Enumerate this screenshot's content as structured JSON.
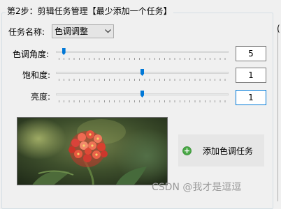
{
  "group": {
    "title": "第2步：剪辑任务管理【最少添加一个任务】"
  },
  "right_frame": {
    "glyph": "("
  },
  "task": {
    "label": "任务名称:",
    "selected": "色调调整"
  },
  "adjustments": {
    "hue": {
      "label": "色调角度:",
      "value": "5",
      "slider_fraction": 0.02
    },
    "saturation": {
      "label": "饱和度:",
      "value": "1",
      "slider_fraction": 0.5
    },
    "brightness": {
      "label": "亮度:",
      "value": "1",
      "slider_fraction": 0.5
    }
  },
  "preview": {
    "icon": "flower-photo"
  },
  "add_button": {
    "label": "添加色调任务",
    "icon": "plus-circle-icon"
  },
  "watermark": {
    "text": "CSDN @我才是逗逗"
  },
  "colors": {
    "accent": "#0078d7",
    "icon_green": "#4aa846"
  }
}
